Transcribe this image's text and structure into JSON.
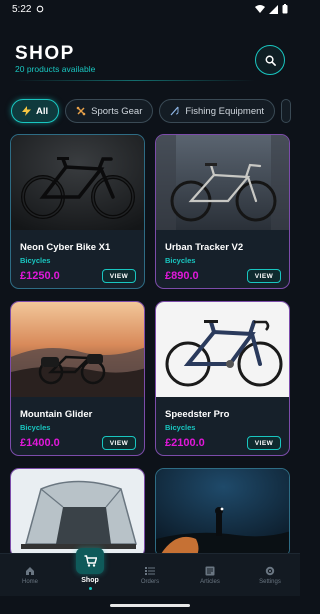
{
  "status": {
    "time": "5:22"
  },
  "header": {
    "title": "SHOP",
    "subtitle": "20 products available"
  },
  "filters": [
    {
      "label": "All",
      "icon": "bolt-icon",
      "active": true
    },
    {
      "label": "Sports Gear",
      "icon": "dumbbell-icon",
      "active": false
    },
    {
      "label": "Fishing Equipment",
      "icon": "fishing-rod-icon",
      "active": false
    }
  ],
  "products": [
    {
      "name": "Neon Cyber Bike X1",
      "category": "Bicycles",
      "price": "£1250.0",
      "view": "VIEW"
    },
    {
      "name": "Urban Tracker V2",
      "category": "Bicycles",
      "price": "£890.0",
      "view": "VIEW"
    },
    {
      "name": "Mountain Glider",
      "category": "Bicycles",
      "price": "£1400.0",
      "view": "VIEW"
    },
    {
      "name": "Speedster Pro",
      "category": "Bicycles",
      "price": "£2100.0",
      "view": "VIEW"
    }
  ],
  "nav": [
    {
      "label": "Home",
      "icon": "home-icon"
    },
    {
      "label": "Shop",
      "icon": "cart-icon",
      "active": true
    },
    {
      "label": "Orders",
      "icon": "list-icon"
    },
    {
      "label": "Articles",
      "icon": "article-icon"
    },
    {
      "label": "Settings",
      "icon": "gear-icon"
    }
  ],
  "colors": {
    "accent": "#19c6c0",
    "price": "#e018d9",
    "background": "#0d1219"
  }
}
